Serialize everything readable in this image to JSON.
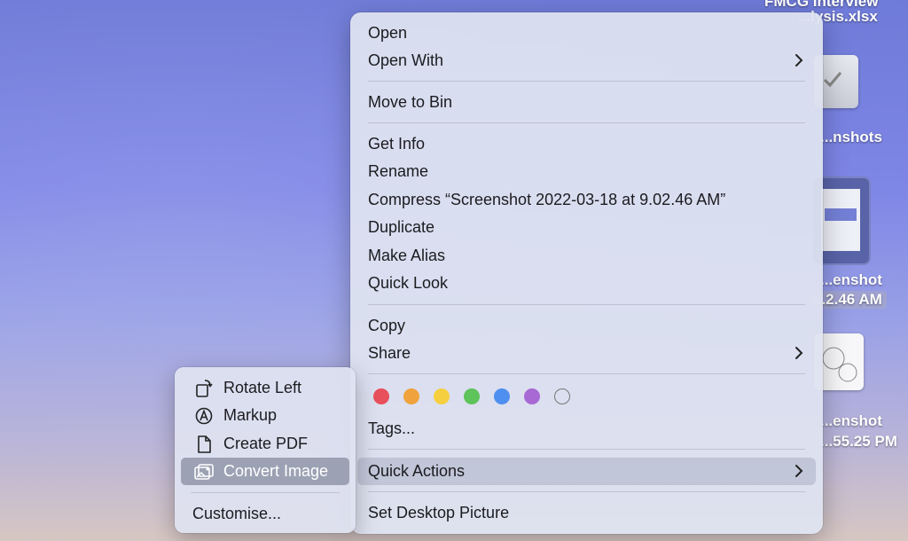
{
  "desktop": {
    "items": [
      {
        "label_line1": "FMCG Interview",
        "label_line2": "...lysis.xlsx"
      },
      {
        "label_line1": "...nshots"
      },
      {
        "label_line1": "...enshot",
        "label_line2": "...2.46 AM"
      },
      {
        "label_line1": "...enshot",
        "label_line2": "...55.25 PM"
      }
    ]
  },
  "context_menu": {
    "groups": [
      [
        {
          "label": "Open"
        },
        {
          "label": "Open With",
          "submenu": true
        }
      ],
      [
        {
          "label": "Move to Bin"
        }
      ],
      [
        {
          "label": "Get Info"
        },
        {
          "label": "Rename"
        },
        {
          "label": "Compress “Screenshot 2022-03-18 at 9.02.46 AM”"
        },
        {
          "label": "Duplicate"
        },
        {
          "label": "Make Alias"
        },
        {
          "label": "Quick Look"
        }
      ],
      [
        {
          "label": "Copy"
        },
        {
          "label": "Share",
          "submenu": true
        }
      ]
    ],
    "tag_colors": [
      "#e8505b",
      "#f0a23c",
      "#f5cf3f",
      "#5ec35a",
      "#4f8ff0",
      "#a869d4",
      "none"
    ],
    "tags_label": "Tags...",
    "quick_actions_label": "Quick Actions",
    "set_desktop_label": "Set Desktop Picture"
  },
  "quick_actions_submenu": {
    "items": [
      {
        "label": "Rotate Left",
        "icon": "rotate-left-icon"
      },
      {
        "label": "Markup",
        "icon": "markup-icon"
      },
      {
        "label": "Create PDF",
        "icon": "document-icon"
      },
      {
        "label": "Convert Image",
        "icon": "image-icon",
        "highlighted": true
      }
    ],
    "customise_label": "Customise..."
  }
}
